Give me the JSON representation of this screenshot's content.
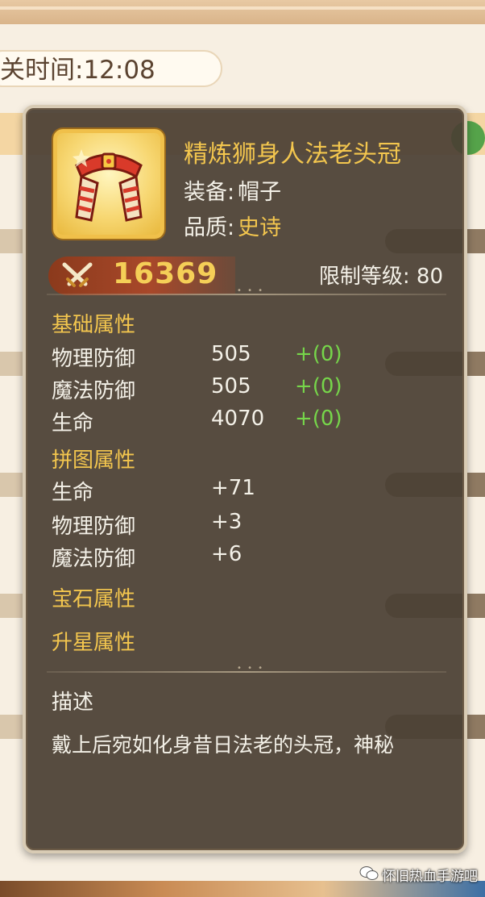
{
  "background": {
    "close_time_label": "关时间:12:08"
  },
  "item": {
    "name": "精炼狮身人法老头冠",
    "equip_label": "装备:",
    "equip_value": "帽子",
    "quality_label": "品质:",
    "quality_value": "史诗",
    "power": "16369",
    "level_requirement": "限制等级: 80",
    "icon": "pharaoh-crown-icon"
  },
  "basic": {
    "title": "基础属性",
    "rows": [
      {
        "name": "物理防御",
        "value": "505",
        "bonus": "+(0)"
      },
      {
        "name": "魔法防御",
        "value": "505",
        "bonus": "+(0)"
      },
      {
        "name": "生命",
        "value": "4070",
        "bonus": "+(0)"
      }
    ]
  },
  "puzzle": {
    "title": "拼图属性",
    "rows": [
      {
        "name": "生命",
        "value": "+71"
      },
      {
        "name": "物理防御",
        "value": "+3"
      },
      {
        "name": "魔法防御",
        "value": "+6"
      }
    ]
  },
  "gem": {
    "title": "宝石属性"
  },
  "star": {
    "title": "升星属性"
  },
  "description": {
    "title": "描述",
    "text": "戴上后宛如化身昔日法老的头冠，神秘"
  },
  "watermark": {
    "text": "怀旧热血手游吧"
  },
  "colors": {
    "gold": "#f3c64e",
    "bonus_green": "#76d64a",
    "card_bg": "#4a4034",
    "power_bar": "#a8482a"
  }
}
